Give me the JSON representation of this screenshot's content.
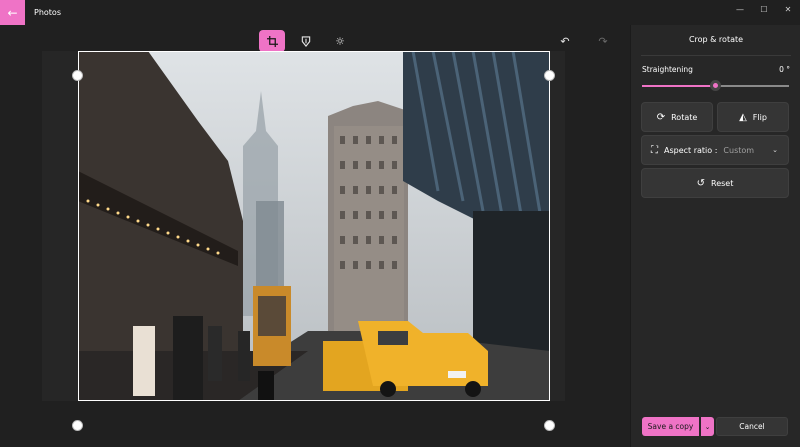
{
  "titlebar": {
    "app_title": "Photos",
    "back_icon": "arrow-left-icon",
    "controls": [
      "minimize",
      "maximize",
      "close"
    ]
  },
  "toolbar": {
    "tools": [
      {
        "name": "crop",
        "icon": "crop-icon",
        "active": true
      },
      {
        "name": "adjust",
        "icon": "filter-icon",
        "active": false
      },
      {
        "name": "brightness",
        "icon": "sun-icon",
        "active": false
      }
    ],
    "undo_icon": "undo-icon",
    "redo_icon": "redo-icon"
  },
  "panel": {
    "title": "Crop & rotate",
    "straightening_label": "Straightening",
    "straightening_value": "0 °",
    "straightening_level": 0.5,
    "rotate_label": "Rotate",
    "flip_label": "Flip",
    "aspect_label": "Aspect ratio :",
    "aspect_value": "Custom",
    "reset_label": "Reset",
    "save_label": "Save a copy",
    "cancel_label": "Cancel"
  },
  "colors": {
    "accent": "#ef73c6",
    "background": "#202020",
    "panel": "#272727"
  }
}
